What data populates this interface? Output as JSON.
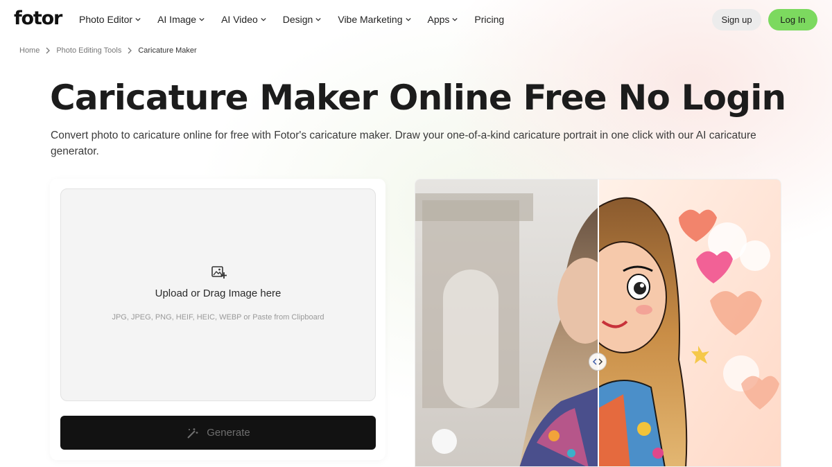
{
  "header": {
    "logo": "fotor",
    "nav": [
      {
        "label": "Photo Editor",
        "dropdown": true
      },
      {
        "label": "AI Image",
        "dropdown": true
      },
      {
        "label": "AI Video",
        "dropdown": true
      },
      {
        "label": "Design",
        "dropdown": true
      },
      {
        "label": "Vibe Marketing",
        "dropdown": true
      },
      {
        "label": "Apps",
        "dropdown": true
      },
      {
        "label": "Pricing",
        "dropdown": false
      }
    ],
    "signup_label": "Sign up",
    "login_label": "Log In"
  },
  "breadcrumb": {
    "items": [
      "Home",
      "Photo Editing Tools"
    ],
    "current": "Caricature Maker"
  },
  "hero": {
    "title": "Caricature Maker Online Free No Login",
    "subtitle": "Convert photo to caricature online for free with Fotor's caricature maker. Draw your one-of-a-kind caricature portrait in one click with our AI caricature generator."
  },
  "upload": {
    "icon": "image-add-icon",
    "label": "Upload or Drag Image here",
    "formats": "JPG, JPEG, PNG, HEIF, HEIC, WEBP or Paste from Clipboard"
  },
  "generate": {
    "icon": "magic-wand-icon",
    "label": "Generate"
  },
  "colors": {
    "brand_green": "#7cd95f",
    "generate_bg": "#121212"
  }
}
